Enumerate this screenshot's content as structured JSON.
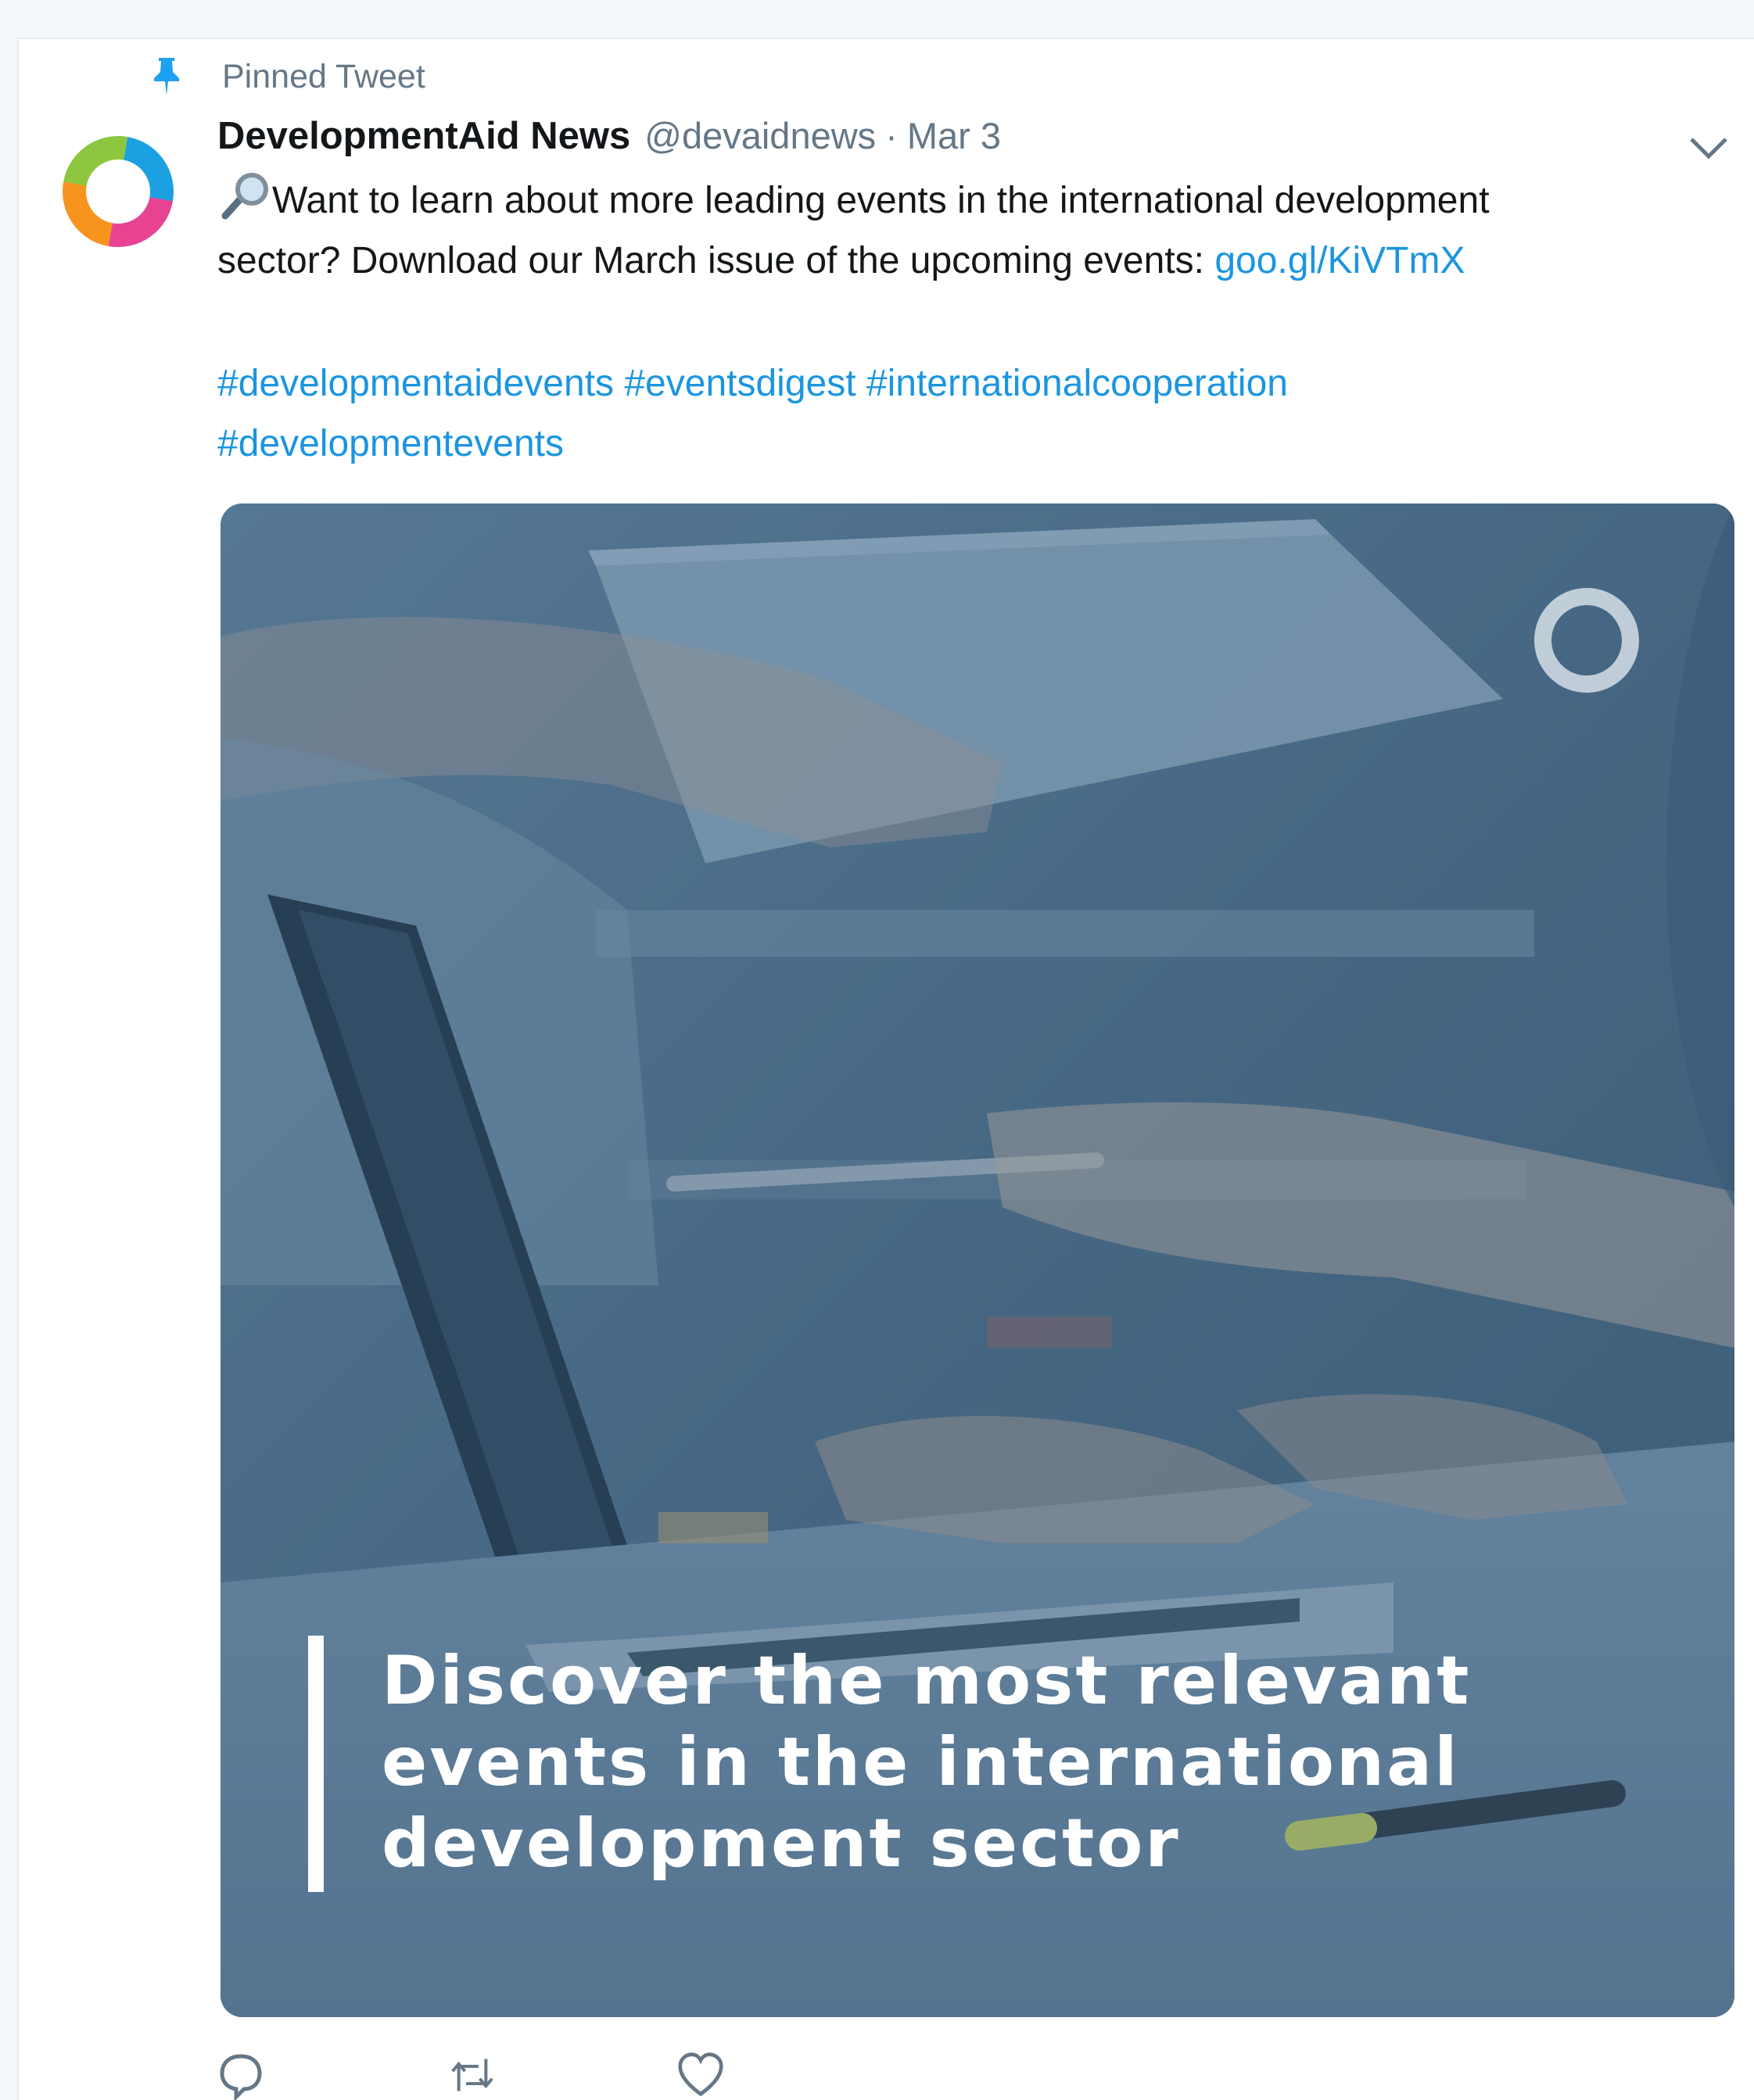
{
  "pinned": {
    "label": "Pinned Tweet",
    "icon": "pin-icon",
    "icon_color": "#1da1f2"
  },
  "author": {
    "display_name": "DevelopmentAid News",
    "handle": "@devaidnews",
    "separator": "·",
    "date": "Mar 3",
    "avatar_icon": "developmentaid-logo-icon",
    "brand_colors": [
      "#8dc63f",
      "#1ba1e2",
      "#e84393",
      "#f7941d"
    ]
  },
  "menu": {
    "icon": "chevron-down-icon"
  },
  "tweet": {
    "emoji_icon": "magnifying-glass-icon",
    "text_line1": "Want to learn about more leading events in the international development",
    "text_line2_prefix": "sector? Download our March issue of the upcoming events: ",
    "link": "goo.gl/KiVTmX",
    "hashtags_line1": "#developmentaidevents #eventsdigest #internationalcooperation",
    "hashtags_line2": "#developmentevents"
  },
  "media": {
    "caption_line1": "Discover the most relevant",
    "caption_line2": "events in the international",
    "caption_line3": "development sector",
    "overlay_color": "#4a6f8f"
  },
  "actions": {
    "reply_icon": "reply-icon",
    "retweet_icon": "retweet-icon",
    "like_icon": "heart-icon"
  },
  "colors": {
    "link": "#1b95e0",
    "secondary_text": "#657786",
    "primary_text": "#14171a"
  }
}
